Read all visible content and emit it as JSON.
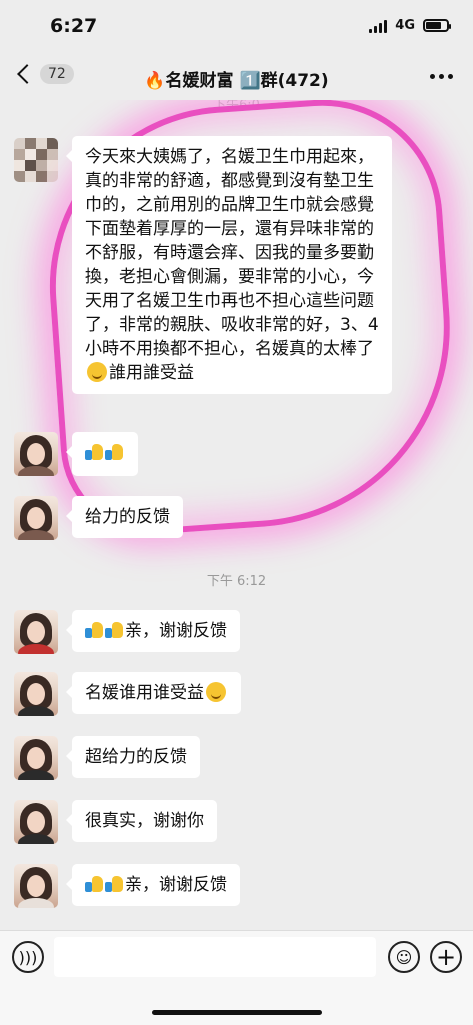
{
  "status": {
    "time": "6:27",
    "network": "4G",
    "battery_level": 0.7
  },
  "nav": {
    "back_count": "72",
    "title": "🔥名媛财富 1️⃣群(472)"
  },
  "chat": {
    "top_time_partial": "下午6:0",
    "messages": [
      {
        "text": "今天來大姨媽了，名媛卫生巾用起來，真的非常的舒適，都感覺到沒有墊卫生巾的，之前用別的品牌卫生巾就会感覺下面墊着厚厚的一层，還有异味非常的不舒服，有時還会痒、因我的量多要勤換，老担心會側漏，要非常的小心，今天用了名媛卫生巾再也不担心這些问题了，非常的親肤、吸收非常的好，3、4小時不用換都不担心，名媛真的太棒了",
        "suffix": "誰用誰受益"
      },
      {
        "text": ""
      },
      {
        "text": "给力的反馈"
      },
      {
        "time": "下午 6:12"
      },
      {
        "text": "亲，谢谢反馈"
      },
      {
        "text": "名媛谁用谁受益"
      },
      {
        "text": "超给力的反馈"
      },
      {
        "text": "很真实，谢谢你"
      },
      {
        "text": "亲，谢谢反馈"
      }
    ]
  },
  "icons": {
    "voice": "voice-icon",
    "emoji": "emoji-icon",
    "plus": "plus-icon",
    "thumbs": "thumbs-up-icon"
  }
}
